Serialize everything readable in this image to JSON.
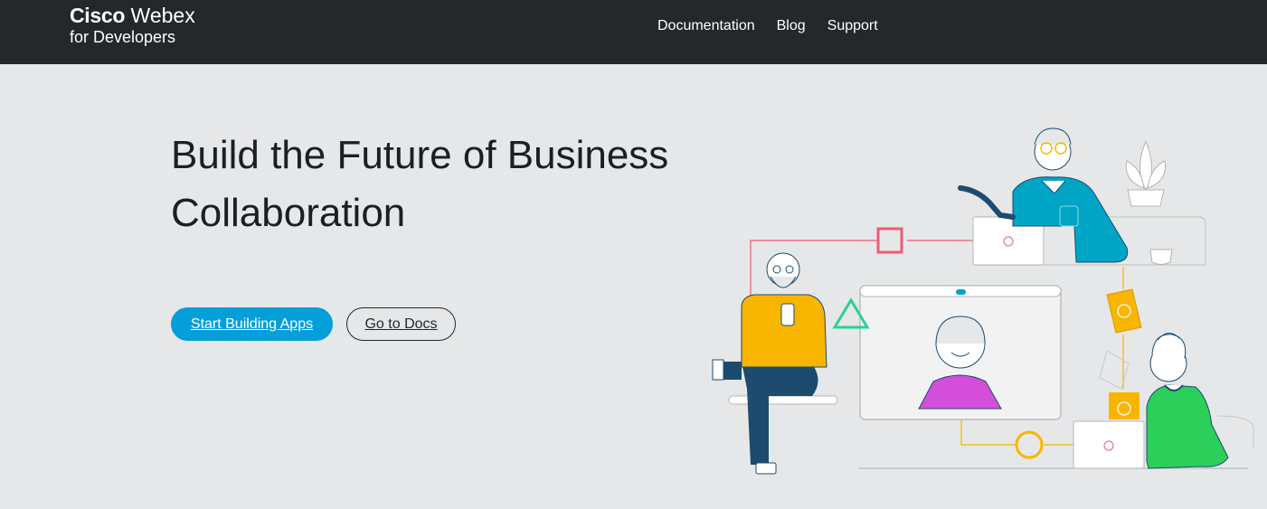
{
  "brand": {
    "cisco": "Cisco",
    "webex": "Webex",
    "subtitle": "for Developers"
  },
  "nav": {
    "items": [
      "Documentation",
      "Blog",
      "Support"
    ]
  },
  "hero": {
    "title": "Build the Future of Business Collaboration",
    "primary_button": "Start Building Apps",
    "secondary_button": "Go to Docs"
  },
  "colors": {
    "header_bg": "#25282a",
    "page_bg": "#e6e7e8",
    "primary": "#049fd9"
  }
}
